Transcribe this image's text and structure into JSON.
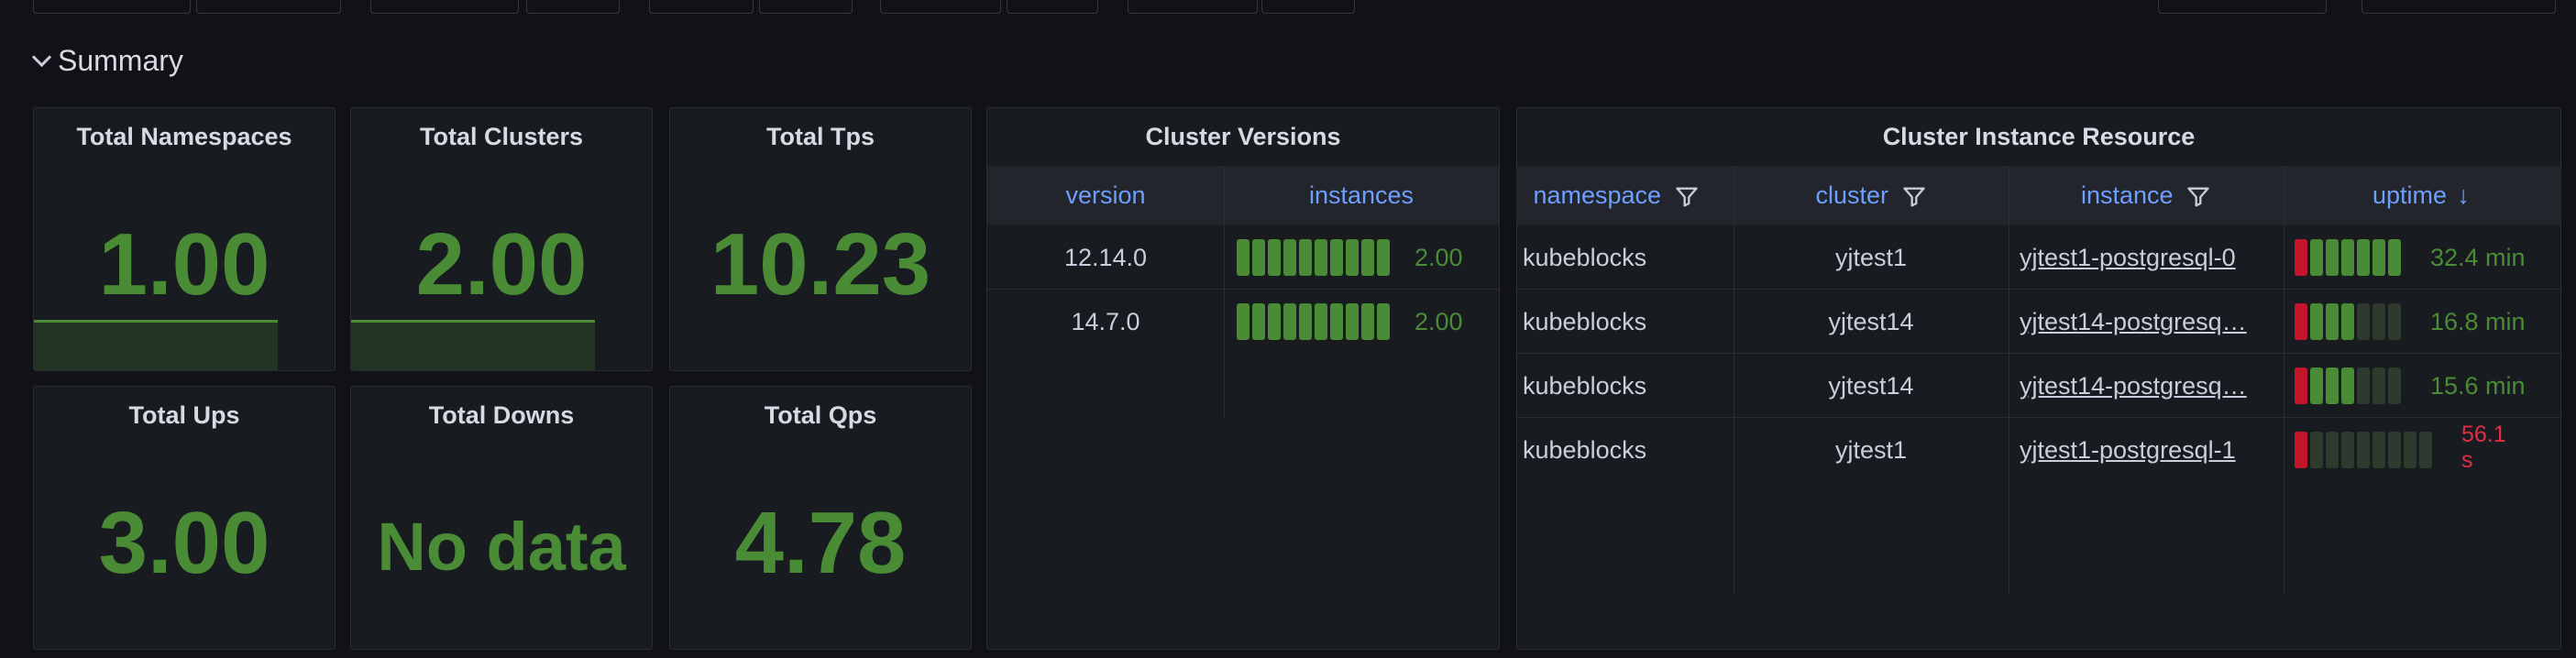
{
  "row": {
    "title": "Summary"
  },
  "stats": {
    "total_namespaces": {
      "title": "Total Namespaces",
      "value": "1.00"
    },
    "total_clusters": {
      "title": "Total Clusters",
      "value": "2.00"
    },
    "total_tps": {
      "title": "Total Tps",
      "value": "10.23"
    },
    "total_ups": {
      "title": "Total Ups",
      "value": "3.00"
    },
    "total_downs": {
      "title": "Total Downs",
      "value": "No data"
    },
    "total_qps": {
      "title": "Total Qps",
      "value": "4.78"
    }
  },
  "versions": {
    "title": "Cluster Versions",
    "columns": [
      "version",
      "instances"
    ],
    "rows": [
      {
        "version": "12.14.0",
        "instances": "2.00"
      },
      {
        "version": "14.7.0",
        "instances": "2.00"
      }
    ]
  },
  "resource": {
    "title": "Cluster Instance Resource",
    "columns": [
      "namespace",
      "cluster",
      "instance",
      "uptime"
    ],
    "sort_indicator": "↓",
    "rows": [
      {
        "namespace": "kubeblocks",
        "cluster": "yjtest1",
        "instance": "yjtest1-postgresql-0",
        "uptime": "32.4 min"
      },
      {
        "namespace": "kubeblocks",
        "cluster": "yjtest14",
        "instance": "yjtest14-postgresq…",
        "uptime": "16.8 min"
      },
      {
        "namespace": "kubeblocks",
        "cluster": "yjtest14",
        "instance": "yjtest14-postgresq…",
        "uptime": "15.6 min"
      },
      {
        "namespace": "kubeblocks",
        "cluster": "yjtest1",
        "instance": "yjtest1-postgresql-1",
        "uptime": "56.1 s"
      }
    ]
  },
  "colors": {
    "green": "#4a8c35",
    "red": "#c4162a",
    "link_blue": "#6e9fff",
    "background": "#111217",
    "panel": "#181b1f"
  }
}
